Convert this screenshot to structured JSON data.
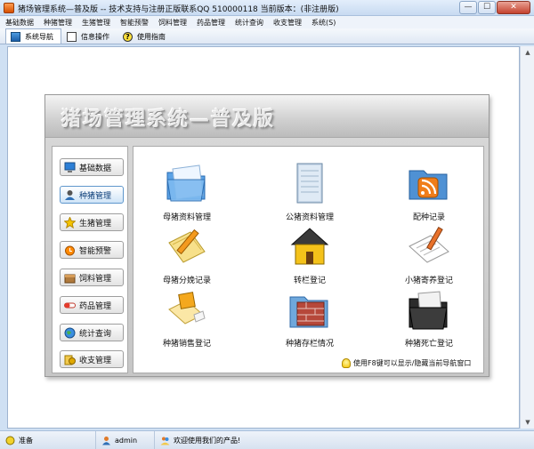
{
  "window": {
    "title": "猪场管理系统—普及版 -- 技术支持与注册正版联系QQ 510000118    当前版本：(非注册版)",
    "min": "—",
    "max": "☐",
    "close": "✕"
  },
  "menu": [
    "基础数据",
    "种猪管理",
    "生猪管理",
    "智能预警",
    "饲料管理",
    "药品管理",
    "统计查询",
    "收支管理",
    "系统(S)"
  ],
  "tabs": [
    {
      "label": "系统导航",
      "icon": "monitor-icon",
      "active": true
    },
    {
      "label": "信息操作",
      "icon": "document-icon",
      "active": false
    },
    {
      "label": "使用指南",
      "icon": "help-icon",
      "active": false
    }
  ],
  "panel": {
    "title": "猪场管理系统—普及版",
    "nav": [
      {
        "label": "基础数据",
        "icon": "monitor-icon",
        "active": false
      },
      {
        "label": "种猪管理",
        "icon": "user-icon",
        "active": true
      },
      {
        "label": "生猪管理",
        "icon": "star-icon",
        "active": false
      },
      {
        "label": "智能预警",
        "icon": "alarm-icon",
        "active": false
      },
      {
        "label": "饲料管理",
        "icon": "box-icon",
        "active": false
      },
      {
        "label": "药品管理",
        "icon": "pill-icon",
        "active": false
      },
      {
        "label": "统计查询",
        "icon": "globe-icon",
        "active": false
      },
      {
        "label": "收支管理",
        "icon": "money-icon",
        "active": false
      }
    ],
    "items": [
      {
        "label": "母猪资料管理",
        "icon": "folder-icon"
      },
      {
        "label": "公猪资料管理",
        "icon": "notepad-icon"
      },
      {
        "label": "配种记录",
        "icon": "rss-folder-icon"
      },
      {
        "label": "母猪分娩记录",
        "icon": "pencil-notes-icon"
      },
      {
        "label": "转栏登记",
        "icon": "house-icon"
      },
      {
        "label": "小猪寄养登记",
        "icon": "writing-icon"
      },
      {
        "label": "种猪销售登记",
        "icon": "chart-notes-icon"
      },
      {
        "label": "种猪存栏情况",
        "icon": "brick-folder-icon"
      },
      {
        "label": "种猪死亡登记",
        "icon": "black-folder-icon"
      }
    ],
    "tip": "使用F8键可以显示/隐藏当前导航窗口"
  },
  "status": {
    "ready": "准备",
    "user": "admin",
    "welcome": "欢迎使用我们的产品!"
  }
}
